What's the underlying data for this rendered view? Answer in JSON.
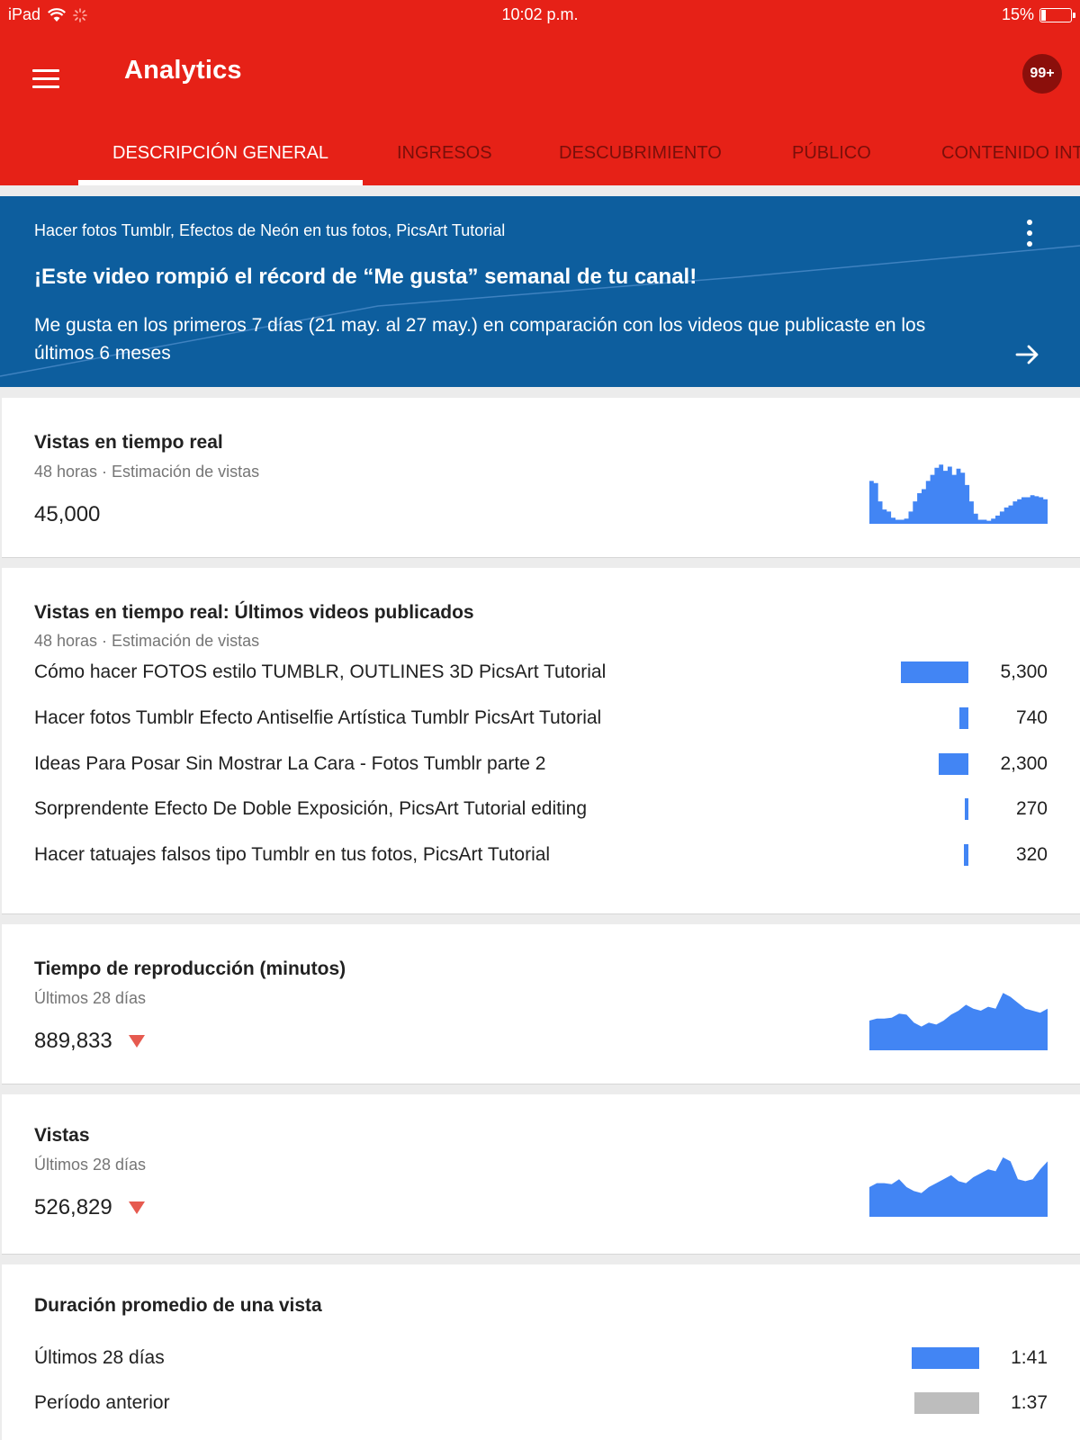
{
  "status_bar": {
    "device": "iPad",
    "time": "10:02 p.m.",
    "battery": "15%",
    "battery_level": 0.15
  },
  "app_bar": {
    "title": "Analytics",
    "notifications": "99+"
  },
  "tabs": [
    {
      "label": "DESCRIPCIÓN GENERAL",
      "active": true
    },
    {
      "label": "INGRESOS"
    },
    {
      "label": "DESCUBRIMIENTO"
    },
    {
      "label": "PÚBLICO"
    },
    {
      "label": "CONTENIDO INTERACTIVO"
    }
  ],
  "banner": {
    "video": "Hacer fotos Tumblr, Efectos de Neón en tus fotos, PicsArt Tutorial",
    "title": "¡Este video rompió el récord de “Me gusta” semanal de tu canal!",
    "description": "Me gusta en los primeros 7 días (21 may. al 27 may.) en comparación con los videos que publicaste en los últimos 6 meses"
  },
  "cards": {
    "realtime": {
      "title": "Vistas en tiempo real",
      "subtitle": "48 horas · Estimación de vistas",
      "value": "45,000",
      "spark": [
        42,
        40,
        22,
        14,
        12,
        6,
        4,
        4,
        5,
        12,
        22,
        30,
        34,
        42,
        48,
        55,
        58,
        52,
        56,
        48,
        54,
        50,
        38,
        22,
        10,
        4,
        4,
        3,
        5,
        8,
        12,
        16,
        18,
        22,
        24,
        26,
        26,
        28,
        27,
        26,
        24
      ]
    },
    "latest_videos": {
      "title": "Vistas en tiempo real: Últimos videos publicados",
      "subtitle": "48 horas · Estimación de vistas",
      "items": [
        {
          "label": "Cómo hacer FOTOS estilo TUMBLR, OUTLINES 3D PicsArt Tutorial",
          "value": "5,300",
          "views": 5300
        },
        {
          "label": "Hacer fotos Tumblr Efecto Antiselfie Artística Tumblr PicsArt Tutorial",
          "value": "740",
          "views": 740
        },
        {
          "label": "Ideas Para Posar Sin Mostrar La Cara - Fotos Tumblr parte 2",
          "value": "2,300",
          "views": 2300
        },
        {
          "label": "Sorprendente Efecto De Doble Exposición, PicsArt Tutorial editing",
          "value": "270",
          "views": 270
        },
        {
          "label": "Hacer tatuajes falsos tipo Tumblr en tus fotos, PicsArt Tutorial",
          "value": "320",
          "views": 320
        }
      ]
    },
    "watch_time": {
      "title": "Tiempo de reproducción (minutos)",
      "subtitle": "Últimos 28 días",
      "value": "889,833",
      "spark": [
        30,
        32,
        32,
        33,
        37,
        36,
        28,
        24,
        28,
        26,
        30,
        36,
        40,
        46,
        42,
        40,
        44,
        42,
        58,
        54,
        48,
        42,
        40,
        38,
        42
      ]
    },
    "views": {
      "title": "Vistas",
      "subtitle": "Últimos 28 días",
      "value": "526,829",
      "spark": [
        30,
        34,
        34,
        33,
        38,
        30,
        26,
        24,
        30,
        34,
        38,
        42,
        36,
        34,
        40,
        44,
        48,
        46,
        60,
        56,
        38,
        36,
        38,
        48,
        56
      ]
    },
    "avg_duration": {
      "title": "Duración promedio de una vista",
      "items": [
        {
          "label": "Últimos 28 días",
          "value": "1:41",
          "seconds": 101
        },
        {
          "label": "Período anterior",
          "value": "1:37",
          "seconds": 97
        }
      ]
    }
  },
  "colors": {
    "brand": "#e62117",
    "banner": "#0d5e9e",
    "chart": "#4285f4",
    "down": "#e65a4f",
    "previous": "#bdbdbd"
  }
}
